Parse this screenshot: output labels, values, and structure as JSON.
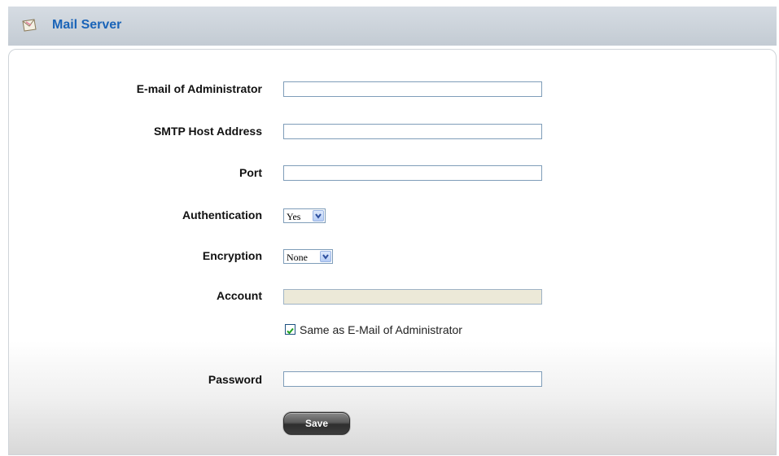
{
  "header": {
    "title": "Mail Server",
    "icon": "envelope-icon"
  },
  "form": {
    "admin_email": {
      "label": "E-mail of Administrator",
      "value": ""
    },
    "smtp_host": {
      "label": "SMTP Host Address",
      "value": ""
    },
    "port": {
      "label": "Port",
      "value": ""
    },
    "authentication": {
      "label": "Authentication",
      "value": "Yes"
    },
    "encryption": {
      "label": "Encryption",
      "value": "None"
    },
    "account": {
      "label": "Account",
      "value": ""
    },
    "same_as_admin": {
      "label": "Same as E-Mail of Administrator",
      "checked": true
    },
    "password": {
      "label": "Password",
      "value": ""
    },
    "save_label": "Save"
  },
  "colors": {
    "title": "#1a64b8",
    "header_bg": "#c8d0d8",
    "input_border": "#7f9db9"
  }
}
